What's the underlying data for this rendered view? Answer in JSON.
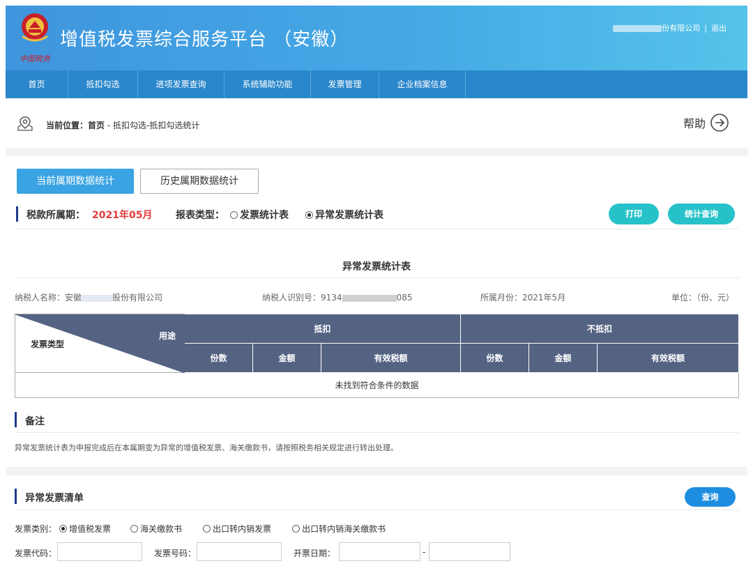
{
  "header": {
    "site_title": "增值税发票综合服务平台 （安徽）",
    "company_suffix": "份有限公司",
    "separator": "|",
    "logout": "退出",
    "logo_text": "中国税务"
  },
  "nav": [
    "首页",
    "抵扣勾选",
    "进项发票查询",
    "系统辅助功能",
    "发票管理",
    "企业档案信息"
  ],
  "breadcrumb": {
    "prefix": "当前位置：",
    "path_bold": "首页",
    "path_rest": " - 抵扣勾选-抵扣勾选统计",
    "help": "帮助"
  },
  "tabs": {
    "active": "当前属期数据统计",
    "other": "历史属期数据统计"
  },
  "period": {
    "label": "税款所属期：",
    "value": "2021年05月"
  },
  "report_type": {
    "label": "报表类型：",
    "options": [
      "发票统计表",
      "异常发票统计表"
    ],
    "selected": "异常发票统计表"
  },
  "buttons": {
    "print": "打印",
    "stat_query": "统计查询",
    "query": "查询"
  },
  "report": {
    "title": "异常发票统计表",
    "taxpayer_name_label": "纳税人名称：",
    "taxpayer_name_prefix": "安徽",
    "taxpayer_name_suffix": "股份有限公司",
    "tax_id_label": "纳税人识别号：",
    "tax_id_prefix": "9134",
    "tax_id_suffix": "085",
    "month_label": "所属月份：",
    "month_value": "2021年5月",
    "unit": "单位：（份、元）"
  },
  "table": {
    "corner_use": "用途",
    "corner_type": "发票类型",
    "group_deduct": "抵扣",
    "group_nodeduct": "不抵扣",
    "cols": [
      "份数",
      "金额",
      "有效税额",
      "份数",
      "金额",
      "有效税额"
    ],
    "empty": "未找到符合条件的数据"
  },
  "remark": {
    "title": "备注",
    "text": "异常发票统计表为申报完成后在本属期变为异常的增值税发票、海关缴款书，请按照税务相关规定进行转出处理。"
  },
  "list": {
    "title": "异常发票清单",
    "category_label": "发票类别：",
    "categories": [
      "增值税发票",
      "海关缴款书",
      "出口转内销发票",
      "出口转内销海关缴款书"
    ],
    "selected_category": "增值税发票",
    "code_label": "发票代码：",
    "number_label": "发票号码：",
    "date_label": "开票日期：",
    "date_sep": "-"
  },
  "colors": {
    "nav": "#2a87cb",
    "tab_active": "#3aa3e3",
    "pill": "#27c2c9",
    "table_head": "#556383",
    "period_value": "#e23c3c"
  }
}
